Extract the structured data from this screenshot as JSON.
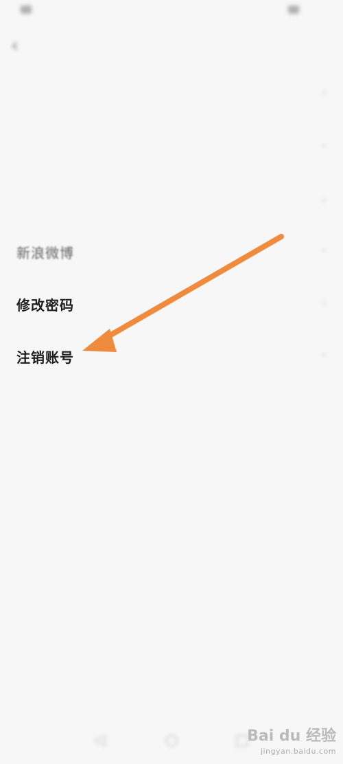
{
  "status_bar": {
    "left_text": "",
    "right_text": ""
  },
  "header": {
    "title": ""
  },
  "rows": [
    {
      "label": "",
      "value": ""
    },
    {
      "label": "",
      "value": ""
    },
    {
      "label": "",
      "value": ""
    },
    {
      "label": "新浪微博",
      "value": ""
    },
    {
      "label": "修改密码",
      "value": ""
    },
    {
      "label": "注销账号",
      "value": ""
    }
  ],
  "watermark": {
    "logo_text": "Bai du 经验",
    "sub_text": "jingyan.baidu.com"
  },
  "colors": {
    "arrow": "#f08a3c",
    "background": "#f7f7f7"
  }
}
